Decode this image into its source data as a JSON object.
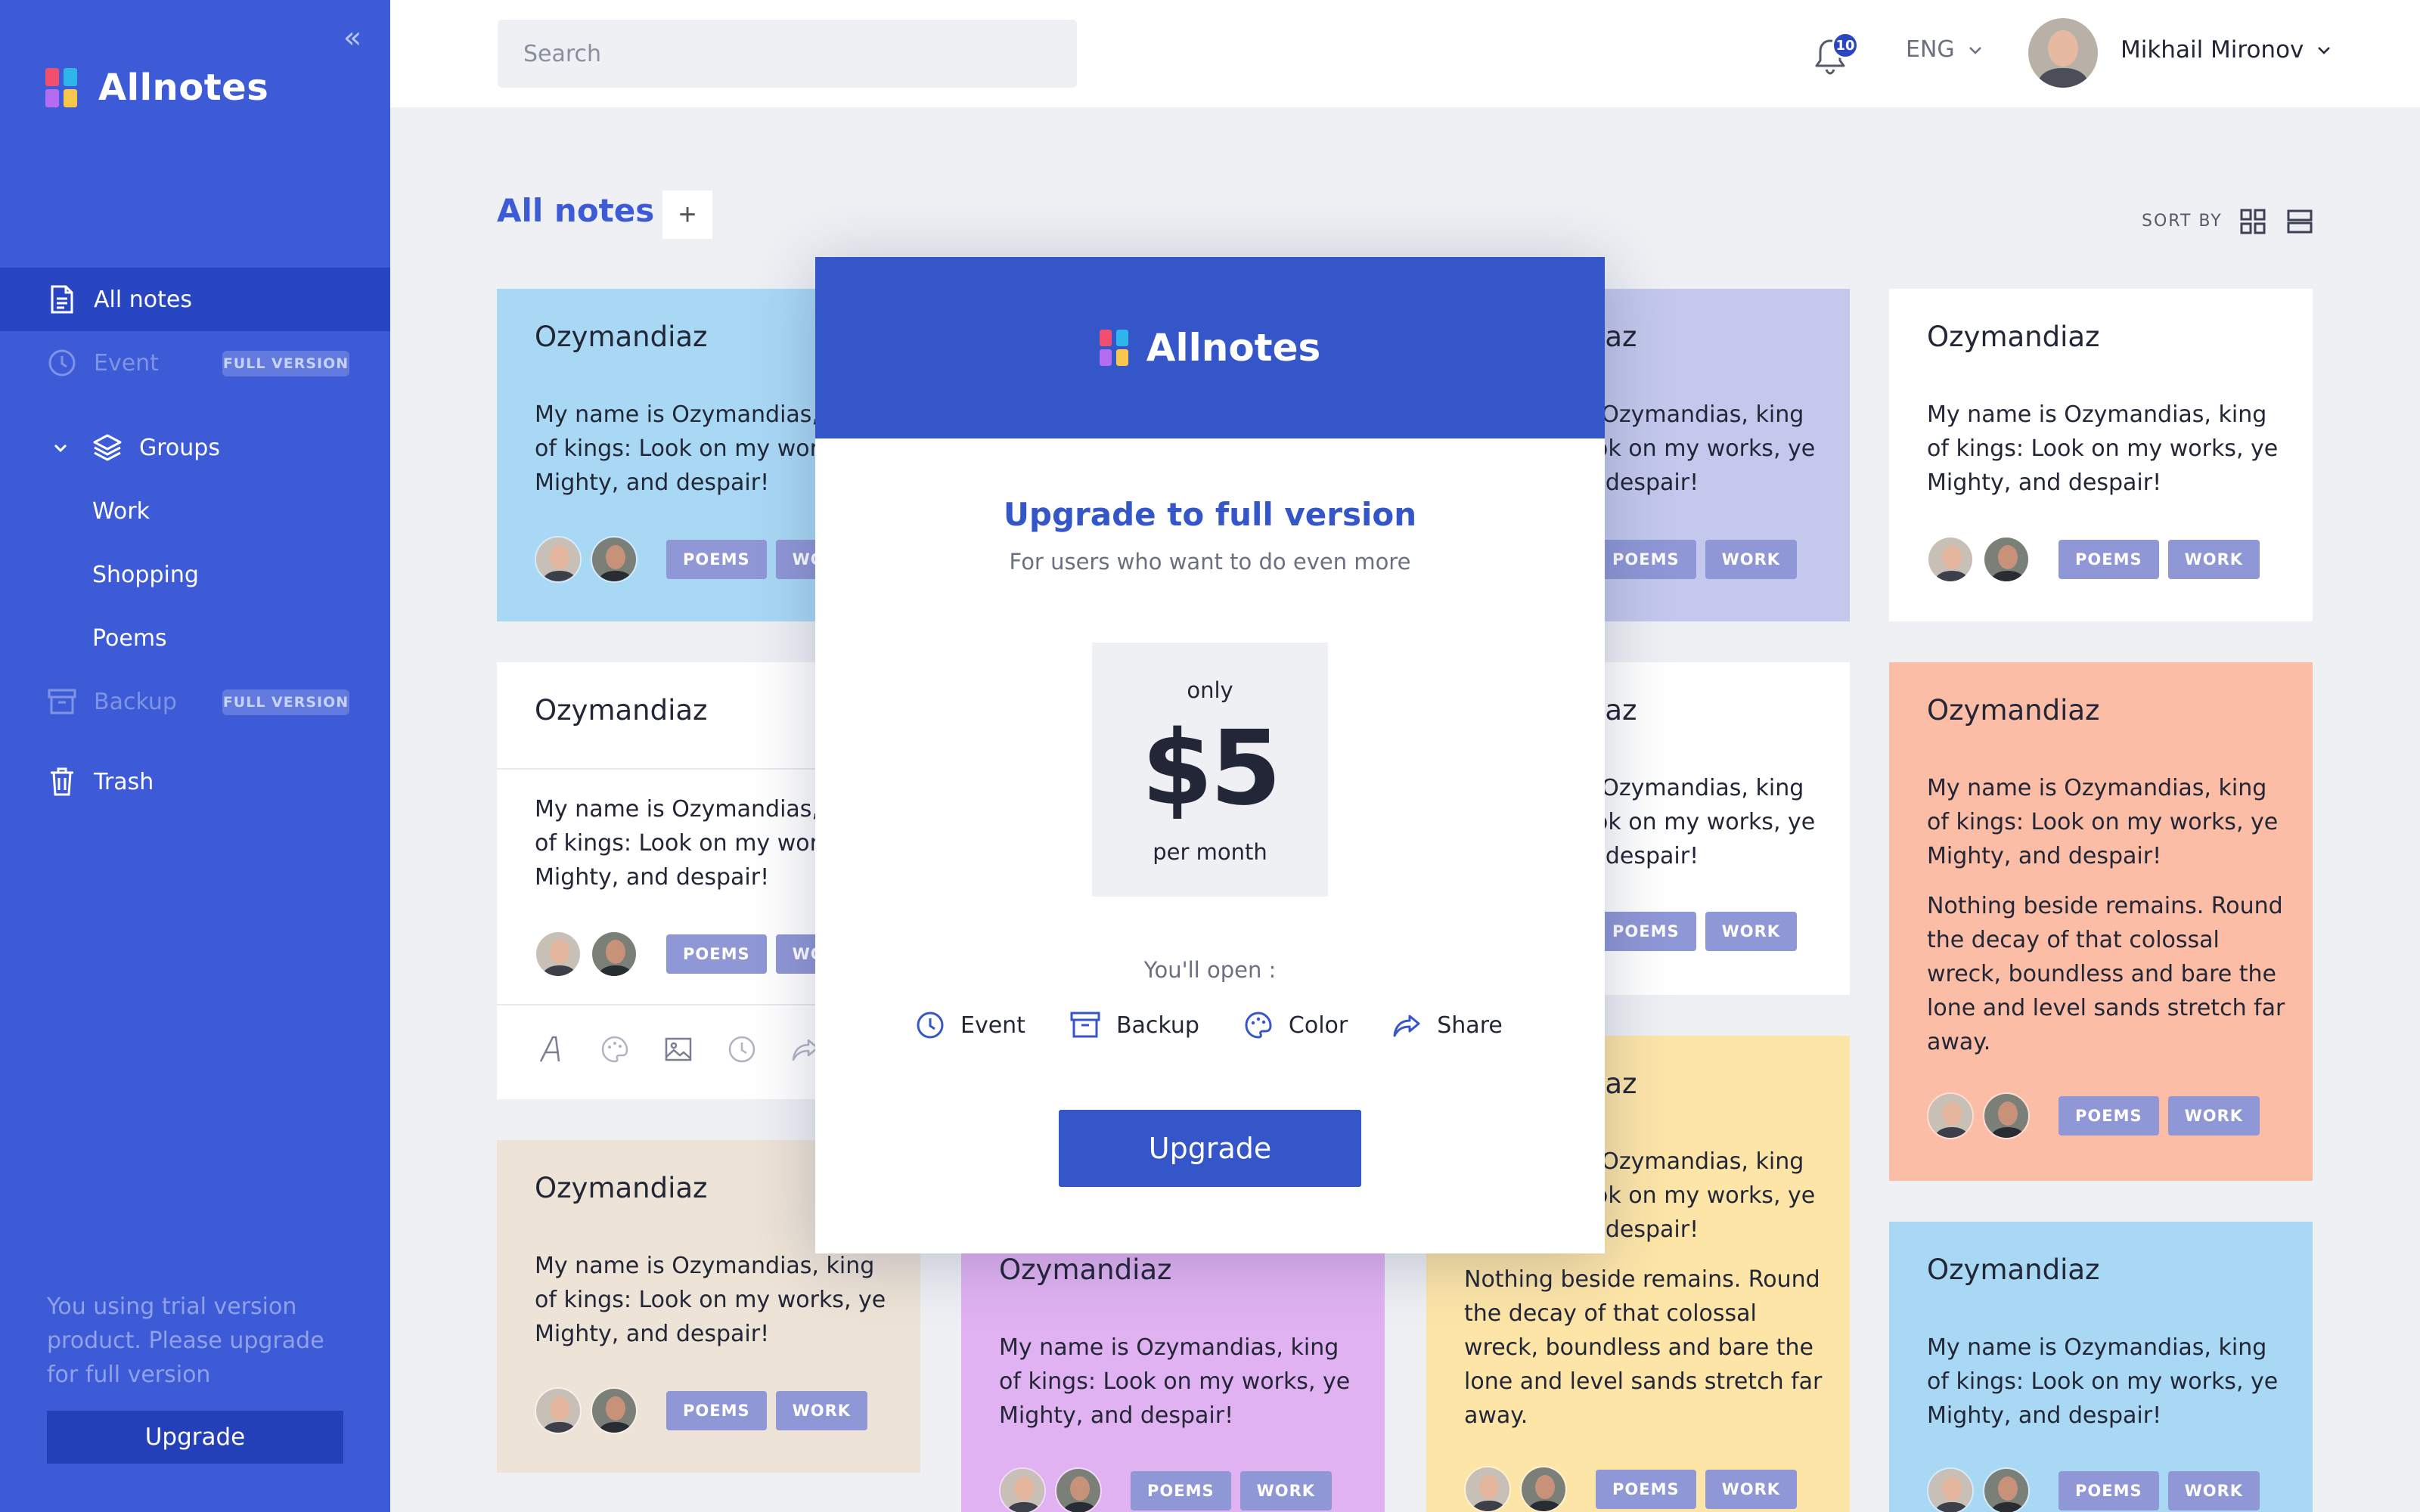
{
  "app": {
    "brand": "Allnotes",
    "logo_colors": [
      "#f04f6f",
      "#2fb5e9",
      "#b46cf0",
      "#f7c64a"
    ]
  },
  "sidebar": {
    "collapse_icon": "double-chevron-left-icon",
    "items": [
      {
        "label": "All notes",
        "icon": "document-icon",
        "active": true
      },
      {
        "label": "Event",
        "icon": "clock-icon",
        "badge": "FULL VERSION"
      },
      {
        "label": "Groups",
        "icon": "layers-icon"
      },
      {
        "label": "Backup",
        "icon": "archive-icon",
        "badge": "FULL VERSION"
      },
      {
        "label": "Trash",
        "icon": "trash-icon"
      }
    ],
    "groups": [
      "Work",
      "Shopping",
      "Poems"
    ],
    "trial_text": "You using trial version product. Please upgrade for full version",
    "upgrade_label": "Upgrade"
  },
  "topbar": {
    "search_placeholder": "Search",
    "notifications_count": "10",
    "language": "ENG",
    "user_name": "Mikhail Mironov"
  },
  "main": {
    "title": "All notes",
    "add_label": "+",
    "sort_label": "SORT BY"
  },
  "note": {
    "title": "Ozymandiaz",
    "text": "My name is Ozymandias, king of kings:  Look on my works, ye Mighty, and despair!",
    "extra": "Nothing beside remains. Round the decay of that colossal wreck, boundless and bare the lone and level sands stretch far away.",
    "tags": [
      "POEMS",
      "WORK"
    ],
    "colors": {
      "blue": "#a9d8f5",
      "lavender": "#c3c8ec",
      "white": "#ffffff",
      "peach": "#fbbda5",
      "beige": "#ede3d6",
      "purple": "#e1b2f2",
      "yellow": "#fde5a8"
    }
  },
  "modal": {
    "brand": "Allnotes",
    "title": "Upgrade to full version",
    "subtitle": "For users who want to do even more",
    "price_prefix": "only",
    "price": "$5",
    "price_suffix": "per month",
    "open_label": "You'll open :",
    "features": [
      {
        "label": "Event",
        "icon": "clock-icon"
      },
      {
        "label": "Backup",
        "icon": "archive-icon"
      },
      {
        "label": "Color",
        "icon": "palette-icon"
      },
      {
        "label": "Share",
        "icon": "share-icon"
      }
    ],
    "upgrade_label": "Upgrade"
  }
}
